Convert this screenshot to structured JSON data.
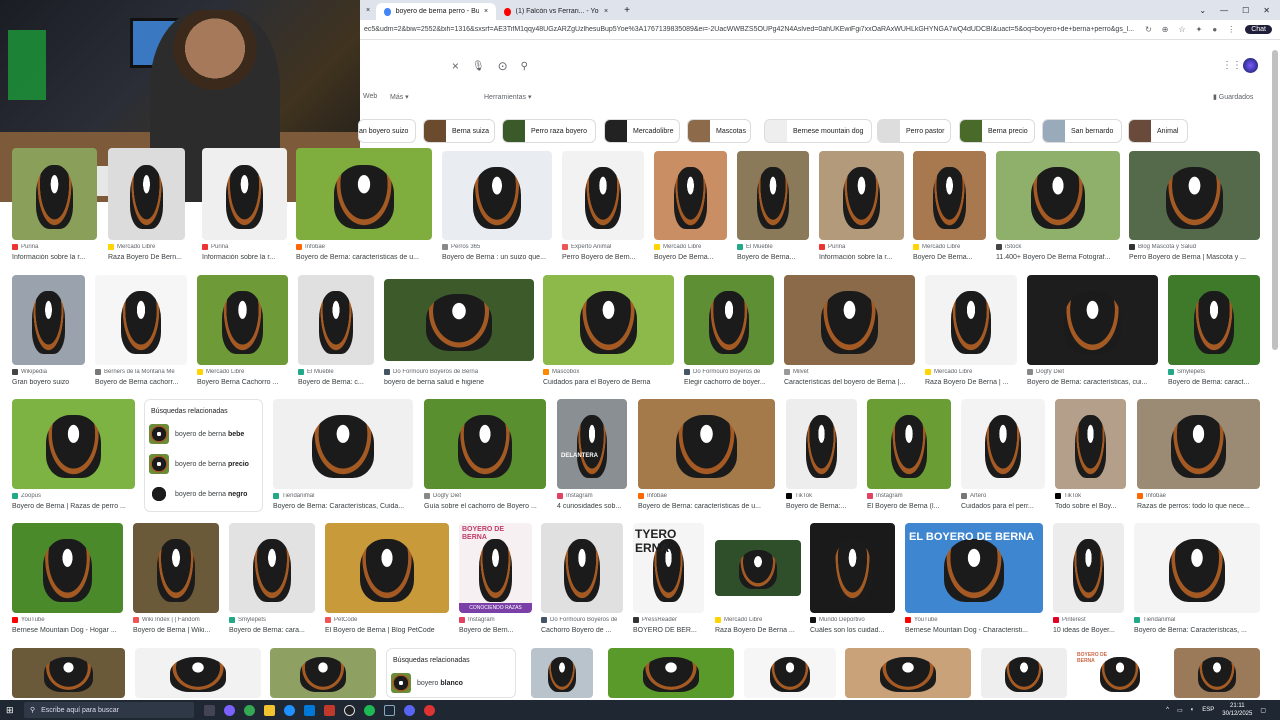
{
  "browser": {
    "tabs": [
      {
        "label": "boyero de berna perro - Buscar c",
        "active": true,
        "color": "#4285f4"
      },
      {
        "label": "(1) Falcón vs Ferrari... - YouTube",
        "active": false,
        "color": "#ff0000"
      }
    ],
    "new_tab": "+",
    "url": "ec5&udm=2&biw=2552&bih=1316&sxsrf=AE3TifM1qqy48UGzARZgUzlhesuBup5Yoe%3A1767139835089&ei=-2UacWWBZS5OUPg42N4Aslved=0ahUKEwiFgi7xxOaRAxWUHLkGHYNGA7wQ4dUDCBI&uact=5&oq=boyero+de+berna+perro&gs_l...",
    "chat_label": "Chat"
  },
  "search": {
    "clear_icon": "×",
    "mic_icon": "🎤",
    "lens_icon": "⊙",
    "search_icon": "🔍"
  },
  "nav": {
    "web": "Web",
    "more": "Más",
    "tools": "Herramientas",
    "saved": "Guardados"
  },
  "chips": [
    {
      "label": "an boyero suizo"
    },
    {
      "label": "Berna suiza"
    },
    {
      "label": "Perro raza boyero"
    },
    {
      "label": "Mercadolibre"
    },
    {
      "label": "Mascotas"
    },
    {
      "label": "Bernese mountain dog"
    },
    {
      "label": "Perro pastor"
    },
    {
      "label": "Berna precio"
    },
    {
      "label": "San bernardo"
    },
    {
      "label": "Animal"
    }
  ],
  "results": [
    {
      "src": "Purina",
      "title": "Información sobre la r..."
    },
    {
      "src": "Mercado Libre",
      "title": "Raza Boyero De Bern..."
    },
    {
      "src": "Purina",
      "title": "Información sobre la r..."
    },
    {
      "src": "Infobae",
      "title": "Boyero de Berna: características de u..."
    },
    {
      "src": "Perros 365",
      "title": "Boyero de Berna : un suizo que..."
    },
    {
      "src": "Experto Animal",
      "title": "Perro Boyero de Bern..."
    },
    {
      "src": "Mercado Libre",
      "title": "Boyero De Berna..."
    },
    {
      "src": "El Mueble",
      "title": "Boyero de Berna..."
    },
    {
      "src": "Purina",
      "title": "Información sobre la r..."
    },
    {
      "src": "Mercado Libre",
      "title": "Boyero De Berna..."
    },
    {
      "src": "iStock",
      "title": "11.400+ Boyero De Berna Fotograf..."
    },
    {
      "src": "Blog Mascota y Salud",
      "title": "Perro Boyero de Berna | Mascota y ..."
    },
    {
      "src": "Wikipedia",
      "title": "Gran boyero suizo"
    },
    {
      "src": "Berners de la Montaña Me",
      "title": "Boyero de Berna cachorr..."
    },
    {
      "src": "Mercado Libre",
      "title": "Boyero Berna Cachorro ..."
    },
    {
      "src": "El Mueble",
      "title": "Boyero de Berna: c..."
    },
    {
      "src": "Do Formouro Boyeros de Berna",
      "title": "boyero de berna salud e higiene"
    },
    {
      "src": "Mascobox",
      "title": "Cuidados para el Boyero de Berna"
    },
    {
      "src": "Do Formouro Boyeros de",
      "title": "Elegir cachorro de boyer..."
    },
    {
      "src": "Milvet",
      "title": "Características del boyero de Berna |..."
    },
    {
      "src": "Mercado Libre",
      "title": "Raza Boyero De Berna | ..."
    },
    {
      "src": "Dogfy Diet",
      "title": "Boyero de Berna: características, cui..."
    },
    {
      "src": "Smylepets",
      "title": "Boyero de Berna: caract..."
    },
    {
      "src": "Zoopus",
      "title": "Boyero de Berna | Razas de perro ..."
    },
    {
      "src": "Tiendanimal",
      "title": "Boyero de Berna: Características, Cuida..."
    },
    {
      "src": "Dogfy Diet",
      "title": "Guía sobre el cachorro de Boyero ..."
    },
    {
      "src": "Instagram",
      "title": "4 curiosidades sob..."
    },
    {
      "src": "Infobae",
      "title": "Boyero de Berna: características de u..."
    },
    {
      "src": "TikTok",
      "title": "Boyero de Berna:..."
    },
    {
      "src": "Instagram",
      "title": "El Boyero de Berna (l..."
    },
    {
      "src": "Artero",
      "title": "Cuidados para el perr..."
    },
    {
      "src": "TikTok",
      "title": "Todo sobre el Boy..."
    },
    {
      "src": "Infobae",
      "title": "Razas de perros: todo lo que nece..."
    },
    {
      "src": "YouTube",
      "title": "Bernese Mountain Dog - Hogar ..."
    },
    {
      "src": "Wiki Index | | Fandom",
      "title": "Boyero de Berna | Wiki..."
    },
    {
      "src": "Smylepets",
      "title": "Boyero de Berna: cara..."
    },
    {
      "src": "PetCode",
      "title": "El Boyero de Berna | Blog PetCode"
    },
    {
      "src": "Instagram",
      "title": "Boyero de Bern..."
    },
    {
      "src": "Do Formouro Boyeros de",
      "title": "Cachorro Boyero de ..."
    },
    {
      "src": "PressReader",
      "title": "BOYERO DE BER..."
    },
    {
      "src": "Mercado Libre",
      "title": "Raza Boyero De Berna ..."
    },
    {
      "src": "Mundo Deportivo",
      "title": "Cuáles son los cuidad..."
    },
    {
      "src": "YouTube",
      "title": "Bernese Mountain Dog - Characteristi..."
    },
    {
      "src": "Pinterest",
      "title": "10 ideas de Boyer..."
    },
    {
      "src": "Tiendanimal",
      "title": "Boyero de Berna: Características, ..."
    }
  ],
  "related1": {
    "header": "Búsquedas relacionadas",
    "items": [
      {
        "prefix": "boyero de berna",
        "bold": "bebe"
      },
      {
        "prefix": "boyero de berna",
        "bold": "precio"
      },
      {
        "prefix": "boyero de berna",
        "bold": "negro"
      }
    ]
  },
  "related2": {
    "header": "Búsquedas relacionadas",
    "items": [
      {
        "prefix": "boyero",
        "bold": "blanco"
      }
    ]
  },
  "image_text": {
    "delantera": "DELANTERA",
    "boyero_title": "EL BOYERO DE BERNA",
    "boyero_de_berna": "BOYERO DE BERNA",
    "conociendo": "CONOCIENDO RAZAS",
    "tyero": "TYERO",
    "erna": "ERNA",
    "boyero_berna_small": "BOYERO DE BERNA"
  },
  "taskbar": {
    "search_placeholder": "Escribe aquí para buscar",
    "lang": "ESP",
    "time": "21:11",
    "date": "30/12/2025"
  }
}
